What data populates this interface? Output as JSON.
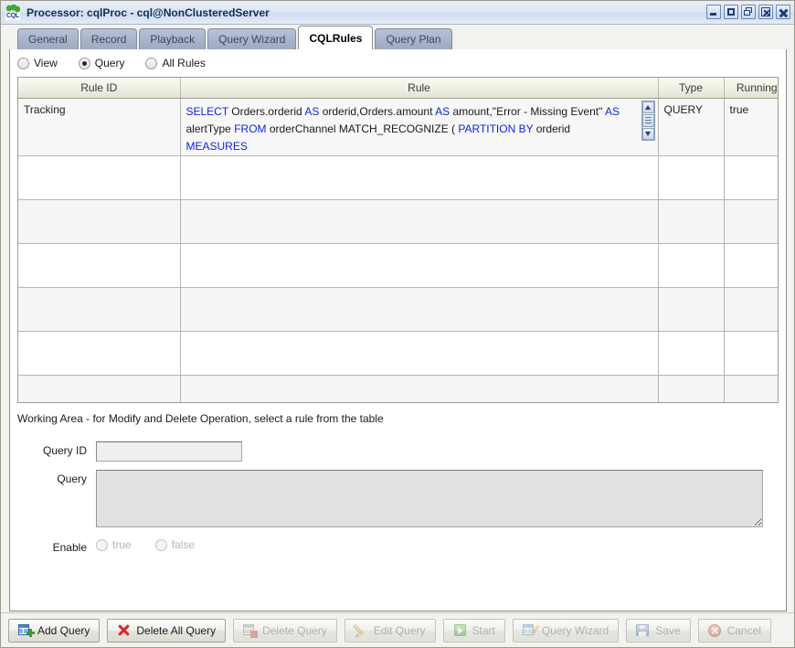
{
  "window": {
    "title": "Processor: cqlProc - cql@NonClusteredServer",
    "icon": "cql-gear-icon",
    "controls": [
      {
        "name": "minimize-button",
        "glyph": "minimize"
      },
      {
        "name": "maximize-button",
        "glyph": "maximize"
      },
      {
        "name": "restore-button",
        "glyph": "restore"
      },
      {
        "name": "close-box-button",
        "glyph": "close-box"
      },
      {
        "name": "close-button",
        "glyph": "close"
      }
    ]
  },
  "tabs": [
    {
      "label": "General",
      "active": false
    },
    {
      "label": "Record",
      "active": false
    },
    {
      "label": "Playback",
      "active": false
    },
    {
      "label": "Query Wizard",
      "active": false
    },
    {
      "label": "CQLRules",
      "active": true
    },
    {
      "label": "Query Plan",
      "active": false
    }
  ],
  "filter": {
    "options": [
      {
        "label": "View",
        "checked": false
      },
      {
        "label": "Query",
        "checked": true
      },
      {
        "label": "All Rules",
        "checked": false
      }
    ]
  },
  "table": {
    "columns": [
      "Rule ID",
      "Rule",
      "Type",
      "Running"
    ],
    "rows": [
      {
        "rule_id": "Tracking",
        "rule_segments": [
          {
            "text": "SELECT",
            "keyword": true
          },
          {
            "text": " Orders.orderid ",
            "keyword": false
          },
          {
            "text": "AS",
            "keyword": true
          },
          {
            "text": " orderid,Orders.amount ",
            "keyword": false
          },
          {
            "text": "AS",
            "keyword": true
          },
          {
            "text": " amount,\"Error - Missing Event\" ",
            "keyword": false
          },
          {
            "text": "AS",
            "keyword": true
          },
          {
            "text": " alertType ",
            "keyword": false
          },
          {
            "text": "FROM",
            "keyword": true
          },
          {
            "text": " orderChannel MATCH_RECOGNIZE ( ",
            "keyword": false
          },
          {
            "text": "PARTITION BY",
            "keyword": true
          },
          {
            "text": " orderid ",
            "keyword": false
          },
          {
            "text": "MEASURES",
            "keyword": true
          }
        ],
        "type": "QUERY",
        "running": "true",
        "has_scrollbar": true
      },
      {
        "rule_id": "",
        "rule_segments": [],
        "type": "",
        "running": "",
        "has_scrollbar": false
      },
      {
        "rule_id": "",
        "rule_segments": [],
        "type": "",
        "running": "",
        "has_scrollbar": false
      },
      {
        "rule_id": "",
        "rule_segments": [],
        "type": "",
        "running": "",
        "has_scrollbar": false
      },
      {
        "rule_id": "",
        "rule_segments": [],
        "type": "",
        "running": "",
        "has_scrollbar": false
      },
      {
        "rule_id": "",
        "rule_segments": [],
        "type": "",
        "running": "",
        "has_scrollbar": false
      },
      {
        "rule_id": "",
        "rule_segments": [],
        "type": "",
        "running": "",
        "has_scrollbar": false
      }
    ]
  },
  "working_area": {
    "hint": "Working Area - for Modify and Delete Operation, select a rule from the table",
    "query_id": {
      "label": "Query ID",
      "value": "",
      "placeholder": ""
    },
    "query": {
      "label": "Query",
      "value": "",
      "placeholder": ""
    },
    "enable": {
      "label": "Enable",
      "options": [
        {
          "label": "true",
          "checked": false,
          "disabled": true
        },
        {
          "label": "false",
          "checked": false,
          "disabled": true
        }
      ]
    }
  },
  "buttons": [
    {
      "label": "Add Query",
      "icon": "add-query-icon",
      "disabled": false
    },
    {
      "label": "Delete All Query",
      "icon": "red-x-icon",
      "disabled": false
    },
    {
      "label": "Delete Query",
      "icon": "delete-query-icon",
      "disabled": true
    },
    {
      "label": "Edit Query",
      "icon": "pencil-icon",
      "disabled": true
    },
    {
      "label": "Start",
      "icon": "play-icon",
      "disabled": true
    },
    {
      "label": "Query Wizard",
      "icon": "query-wizard-icon",
      "disabled": true
    },
    {
      "label": "Save",
      "icon": "floppy-disk-icon",
      "disabled": true
    },
    {
      "label": "Cancel",
      "icon": "cancel-icon",
      "disabled": true
    }
  ],
  "colors": {
    "keyword_blue": "#0f26d8",
    "title_blue": "#14304f",
    "tab_inactive": "#a9b5cb",
    "panel_bg": "#ffffff"
  }
}
